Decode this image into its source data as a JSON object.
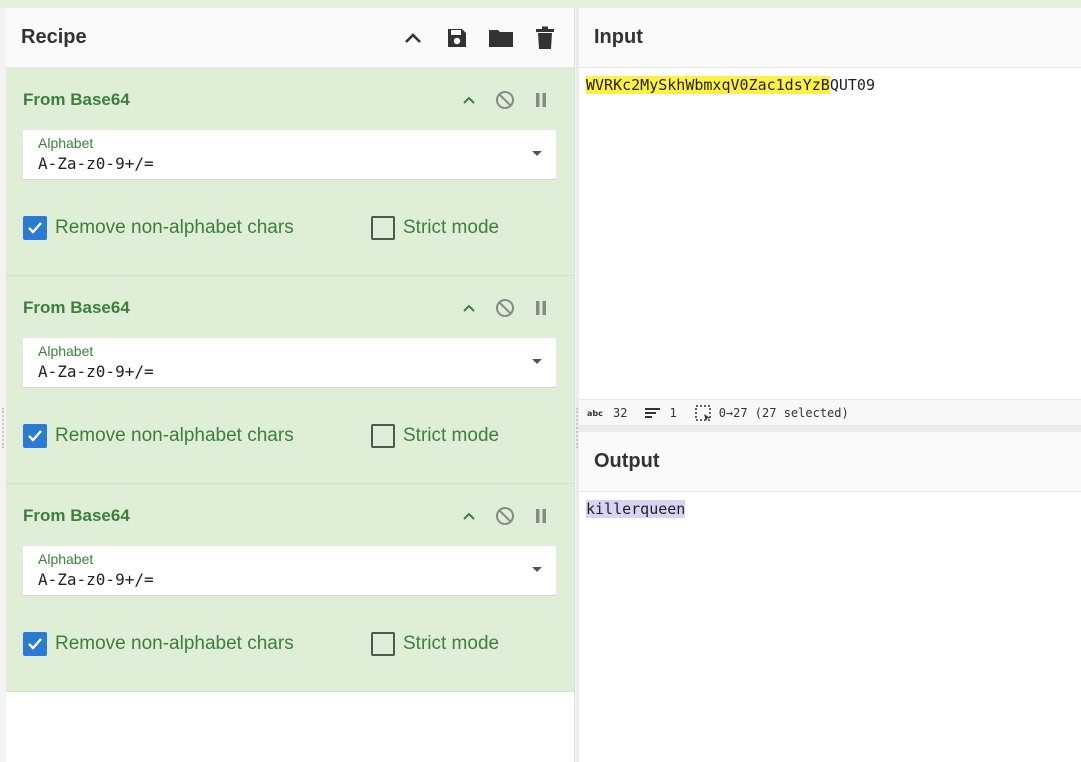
{
  "recipe": {
    "title": "Recipe",
    "operations": [
      {
        "name": "From Base64",
        "alphabet_label": "Alphabet",
        "alphabet_value": "A-Za-z0-9+/=",
        "remove_label": "Remove non-alphabet chars",
        "remove_checked": true,
        "strict_label": "Strict mode",
        "strict_checked": false
      },
      {
        "name": "From Base64",
        "alphabet_label": "Alphabet",
        "alphabet_value": "A-Za-z0-9+/=",
        "remove_label": "Remove non-alphabet chars",
        "remove_checked": true,
        "strict_label": "Strict mode",
        "strict_checked": false
      },
      {
        "name": "From Base64",
        "alphabet_label": "Alphabet",
        "alphabet_value": "A-Za-z0-9+/=",
        "remove_label": "Remove non-alphabet chars",
        "remove_checked": true,
        "strict_label": "Strict mode",
        "strict_checked": false
      }
    ]
  },
  "input": {
    "title": "Input",
    "text_selected": "WVRKc2MySkhWbmxqV0Zac1dsYzB",
    "text_rest": "QUT09"
  },
  "status": {
    "length": "32",
    "lines": "1",
    "selection": "0→27 (27 selected)"
  },
  "output": {
    "title": "Output",
    "text": "killerqueen"
  },
  "colors": {
    "accent_green": "#3c7f3a",
    "op_bg": "#dfefd7",
    "checkbox_blue": "#2b7bd3",
    "input_highlight": "#fff143",
    "output_highlight": "#d7d3f3"
  }
}
